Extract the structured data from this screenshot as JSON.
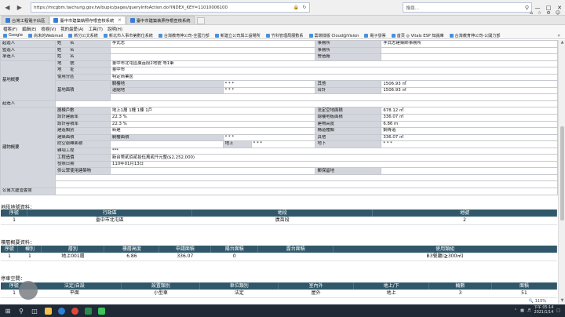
{
  "browser": {
    "url": "https://mcgbm.taichung.gov.tw/bupic/pages/queryInfoAction.do?INDEX_KEY=11010006100",
    "search_placeholder": "搜尋...",
    "tabs": [
      {
        "label": "台灣工程電子佔區",
        "active": false
      },
      {
        "label": "臺中市建築執照存根查核系統",
        "active": true
      },
      {
        "label": "臺中市建築執照存根查核系統",
        "active": false
      }
    ],
    "menu": [
      "檔案(F)",
      "編輯(E)",
      "檢視(V)",
      "我的最愛(A)",
      "工具(T)",
      "說明(H)"
    ],
    "favorites": [
      "Google",
      "尚未的Webmail",
      "新分公文系統",
      "新北市人事市第數位系統",
      "台灣教育伸公司-全國力部",
      "新建立公司與工設場所",
      "竹科管理局服數系",
      "雲端樣版 Cloud@Vision",
      "電子發票",
      "首頁 ◎ Vitals ESP 知識庫",
      "台灣教育伸公司-公開力部"
    ]
  },
  "info": {
    "applicant": {
      "label": "起造人",
      "name_label": "姓　　名",
      "name": "",
      "office_label": "事務所",
      "office": "李式志建築師事務所"
    },
    "designer_name": "李式志",
    "supervisor": {
      "label": "監造人",
      "name_label": "姓　　名",
      "name": "",
      "office_label": "事務所",
      "office": ""
    },
    "contractor": {
      "label": "承造人",
      "name_label": "姓　　名",
      "name": "",
      "reg_label": "營造廠",
      "reg": ""
    },
    "site": {
      "label": "基地概要",
      "lot_label": "地　　號",
      "lot": "臺中市北屯區廣苗段2地號 等1筆",
      "address_label": "地　　址",
      "address": "臺中市",
      "zone_label": "使用分區",
      "zone": "特定商業區",
      "area_label": "基地面積",
      "arcade_label": "騎樓地",
      "arcade": "* * *",
      "other_label": "其他",
      "other": "1506.93 ㎡",
      "retreat_label": "退縮地",
      "retreat": "* * *",
      "total_label": "合計",
      "total": "1506.93 ㎡"
    },
    "proprietor_label": "起造人",
    "building": {
      "label": "建物概要",
      "floors_label": "層棟戶數",
      "floors": "地上1層 1幢 1棟 1戶",
      "legal_open_label": "法定空地面積",
      "legal_open": "678.12 ㎡",
      "coverage_label": "設計建蔽率",
      "coverage": "22.3 %",
      "total_floor_label": "總樓地板面積",
      "total_floor": "336.07 ㎡",
      "far_label": "設計容積率",
      "far": "22.3 %",
      "height_label": "建物高度",
      "height": "6.86 m",
      "type_label": "建造類別",
      "type": "新建",
      "structure_label": "構造種類",
      "structure": "鋼骨造",
      "area_label": "建築面積",
      "arcade_label": "騎樓面積",
      "arcade": "* * *",
      "other_label": "其他",
      "other": "336.07 ㎡",
      "shelter_label": "防空避難面積",
      "above_label": "地上",
      "above": "* * *",
      "below_label": "地下",
      "below": "* * *",
      "misc_label": "雜項工程",
      "misc": "***",
      "cost_label": "工程造價",
      "cost": "新台幣貳佰貳拾伍萬貳仟元整($2,252,000)",
      "issue_label": "發照日期",
      "issue": "110年01月13日",
      "public_label": "供公眾使用建築物",
      "public": "",
      "postal_label": "郵保留地",
      "postal": ""
    },
    "committee_label": "公寓大廈管委會",
    "committee": ""
  },
  "lots": {
    "title": "地段地號資料：",
    "headers": [
      "序號",
      "行政區",
      "地段",
      "地號"
    ],
    "rows": [
      [
        "1",
        "臺中市北屯區",
        "廣苗段",
        "2"
      ]
    ]
  },
  "floors": {
    "title": "樓層概要資料：",
    "headers": [
      "序號",
      "棟別",
      "層別",
      "樓層高度",
      "申請面積",
      "陽台面積",
      "露台面積",
      "使用類組"
    ],
    "rows": [
      [
        "1",
        "1",
        "地上001層",
        "6.86",
        "336.07",
        "0",
        "",
        "B3餐廳(≧300㎡)"
      ]
    ]
  },
  "parking": {
    "title": "停車空間：",
    "headers": [
      "序號",
      "法定/自設",
      "設置類別",
      "車位類別",
      "室內外",
      "地上/下",
      "輛數",
      "面積"
    ],
    "rows": [
      [
        "1",
        "平面",
        "小型車",
        "法定",
        "屋外",
        "地上",
        "3",
        "51"
      ]
    ]
  },
  "status": {
    "zoom": "115%"
  },
  "taskbar": {
    "time": "下午 05:14",
    "date": "2021/1/14"
  }
}
